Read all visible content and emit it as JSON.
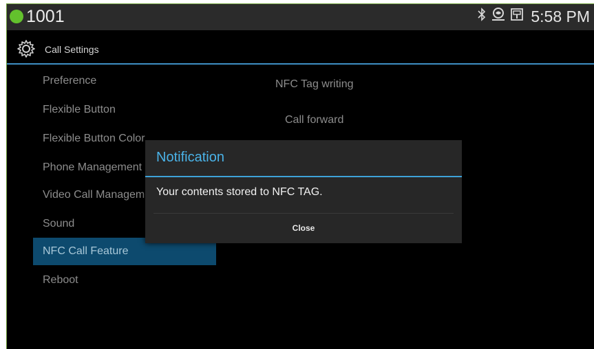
{
  "status_bar": {
    "line_number": "1001",
    "line_status_color": "#63c12d",
    "time": "5:58 PM",
    "icons": [
      "bluetooth-icon",
      "network-icon",
      "sim-icon"
    ]
  },
  "header": {
    "title": "Call Settings",
    "icon": "gear-icon"
  },
  "menu": {
    "items": [
      {
        "label": "Preference"
      },
      {
        "label": "Flexible Button"
      },
      {
        "label": "Flexible Button Color"
      },
      {
        "label": "Phone Management"
      },
      {
        "label": "Video Call Management"
      },
      {
        "label": "Sound"
      },
      {
        "label": "NFC Call Feature",
        "selected": true
      },
      {
        "label": "Reboot"
      }
    ]
  },
  "content": {
    "items": [
      {
        "label": "NFC Tag writing"
      },
      {
        "label": "Call forward"
      }
    ]
  },
  "dialog": {
    "title": "Notification",
    "message": "Your contents stored to NFC TAG.",
    "close_label": "Close"
  },
  "colors": {
    "accent": "#3ea2d8",
    "selected_bg": "#0d4a6e",
    "status_online": "#63c12d"
  }
}
